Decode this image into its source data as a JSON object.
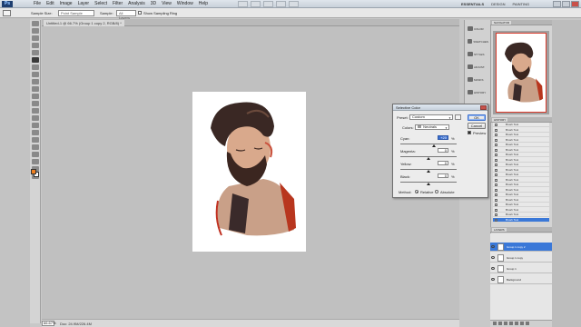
{
  "app": {
    "logo": "Ps",
    "menu": [
      "File",
      "Edit",
      "Image",
      "Layer",
      "Select",
      "Filter",
      "Analysis",
      "3D",
      "View",
      "Window",
      "Help"
    ],
    "workspaces": [
      "ESSENTIALS",
      "DESIGN",
      "PAINTING"
    ],
    "active_workspace": "ESSENTIALS"
  },
  "options_bar": {
    "sample_size_label": "Sample Size:",
    "sample_size_value": "Point Sample",
    "sample_label": "Sample:",
    "sample_value": "All Layers",
    "show_ring_label": "Show Sampling Ring"
  },
  "document": {
    "tab_label": "Untitled-1 @ 66.7% (Group 1 copy 2, RGB/8) *",
    "zoom": "66.67%",
    "info": "Doc: 24.9M/226.4M"
  },
  "dialog": {
    "title": "Selective Color",
    "preset_label": "Preset:",
    "preset_value": "Custom",
    "colors_label": "Colors:",
    "colors_value": "Neutrals",
    "sliders": [
      {
        "label": "Cyan:",
        "value": "+20",
        "unit": "%",
        "position": 0.6
      },
      {
        "label": "Magenta:",
        "value": "0",
        "unit": "%",
        "position": 0.5
      },
      {
        "label": "Yellow:",
        "value": "0",
        "unit": "%",
        "position": 0.5
      },
      {
        "label": "Black:",
        "value": "0",
        "unit": "%",
        "position": 0.5
      }
    ],
    "method_label": "Method:",
    "method_options": [
      "Relative",
      "Absolute"
    ],
    "method_selected": "Relative",
    "ok_label": "OK",
    "cancel_label": "Cancel",
    "preview_label": "Preview",
    "preview_checked": true
  },
  "right_panels": {
    "navigator_tab": "NAVIGATOR",
    "icon_strip": [
      "COLOR",
      "SWATCHES",
      "STYLES",
      "ADJUST.",
      "MASKS",
      "HISTORY"
    ],
    "history_tab": "HISTORY",
    "history_items": [
      "Brush Tool",
      "Brush Tool",
      "Brush Tool",
      "Brush Tool",
      "Brush Tool",
      "Brush Tool",
      "Brush Tool",
      "Brush Tool",
      "Brush Tool",
      "Brush Tool",
      "Brush Tool",
      "Brush Tool",
      "Brush Tool",
      "Brush Tool",
      "Brush Tool",
      "Brush Tool",
      "Brush Tool",
      "Brush Tool",
      "Brush Tool",
      "Brush Tool"
    ],
    "history_selected_index": 19,
    "layers_tab": "LAYERS",
    "layers": [
      {
        "name": "Group 1 copy 2",
        "selected": true
      },
      {
        "name": "Group 1 copy",
        "selected": false
      },
      {
        "name": "Group 1",
        "selected": false
      },
      {
        "name": "Background",
        "selected": false
      }
    ]
  },
  "colors": {
    "foreground": "#f08020",
    "background": "#ffffff",
    "selection": "#3a78d8"
  }
}
